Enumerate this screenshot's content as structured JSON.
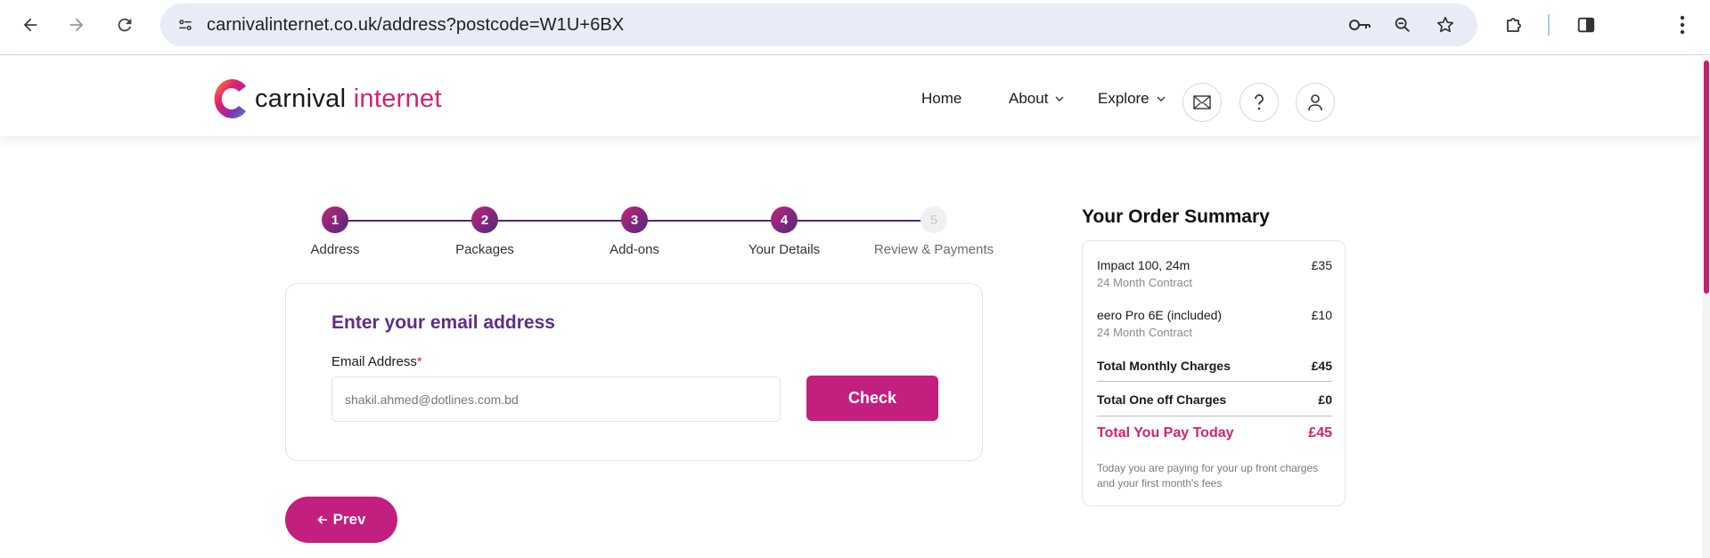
{
  "browser": {
    "url": "carnivalinternet.co.uk/address?postcode=W1U+6BX",
    "icons": [
      "back-arrow-icon",
      "forward-arrow-icon",
      "reload-icon",
      "site-settings-icon",
      "password-key-icon",
      "zoom-icon",
      "bookmark-star-icon",
      "extensions-icon",
      "side-panel-icon",
      "kebab-menu-icon"
    ]
  },
  "header": {
    "logo_word1": "carnival",
    "logo_word2": "internet",
    "nav": [
      {
        "label": "Home"
      },
      {
        "label": "About"
      },
      {
        "label": "Explore"
      }
    ],
    "icons": [
      "mail-icon",
      "help-icon",
      "account-icon"
    ]
  },
  "steps": [
    {
      "number": "1",
      "label": "Address"
    },
    {
      "number": "2",
      "label": "Packages"
    },
    {
      "number": "3",
      "label": "Add-ons"
    },
    {
      "number": "4",
      "label": "Your Details"
    },
    {
      "number": "5",
      "label": "Review & Payments"
    }
  ],
  "email_form": {
    "title": "Enter your email address",
    "label": "Email Address",
    "required_mark": "*",
    "value": "shakil.ahmed@dotlines.com.bd",
    "button": "Check"
  },
  "prev_button": "Prev",
  "summary": {
    "title": "Your Order Summary",
    "items": [
      {
        "name": "Impact 100, 24m",
        "price": "£35",
        "term": "24 Month Contract"
      },
      {
        "name": "eero Pro 6E (included)",
        "price": "£10",
        "term": "24 Month Contract"
      }
    ],
    "monthly_label": "Total Monthly Charges",
    "monthly_value": "£45",
    "oneoff_label": "Total One off Charges",
    "oneoff_value": "£0",
    "today_label": "Total You Pay Today",
    "today_value": "£45",
    "note": "Today you are paying for your up front charges and your first month's fees"
  },
  "colors": {
    "brand_pink": "#c21f7e",
    "brand_purple": "#5e2e86"
  }
}
